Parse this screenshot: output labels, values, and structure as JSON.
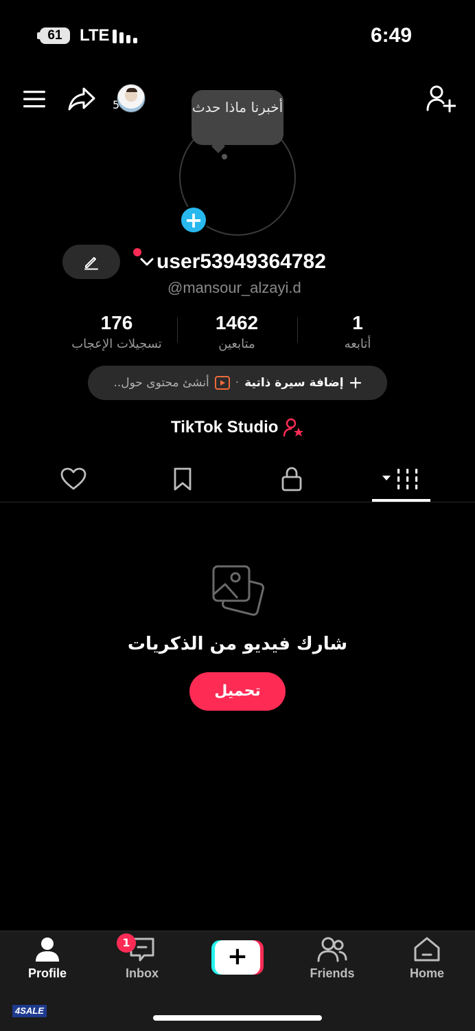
{
  "status_bar": {
    "battery": "61",
    "network": "LTE",
    "time": "6:49"
  },
  "top_bar": {
    "story_count": "5"
  },
  "profile": {
    "bubble_text": "أخبرنا ماذا حدث",
    "username": "user53949364782",
    "handle": "@mansour_alzayi.d"
  },
  "stats": [
    {
      "value": "176",
      "label": "تسجيلات الإعجاب"
    },
    {
      "value": "1462",
      "label": "متابعين"
    },
    {
      "value": "1",
      "label": "أتابعه"
    }
  ],
  "bio": {
    "add_label": "إضافة سيرة ذاتية",
    "separator": "·",
    "create_label": "أنشئ محتوى حول.."
  },
  "studio": {
    "label": "TikTok Studio"
  },
  "empty_state": {
    "title": "شارك فيديو من الذكريات",
    "button_label": "تحميل"
  },
  "bottom_nav": {
    "profile": "Profile",
    "inbox": "Inbox",
    "inbox_badge": "1",
    "friends": "Friends",
    "home": "Home"
  },
  "watermark": "4SALE",
  "colors": {
    "accent": "#fe2c55",
    "cyan": "#25f4ee",
    "plus_blue": "#27b8ee"
  }
}
